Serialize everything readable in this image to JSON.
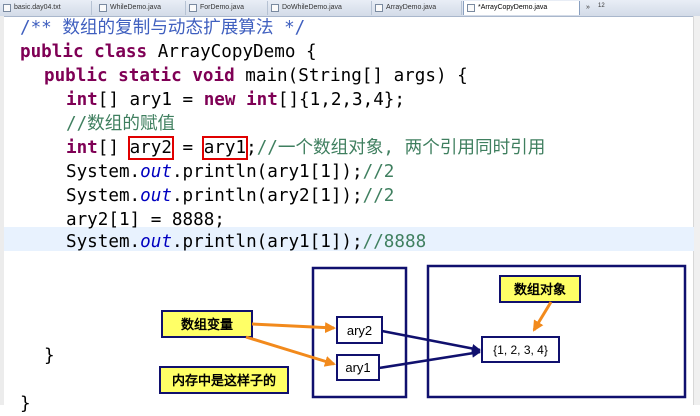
{
  "tabs": [
    {
      "label": "basic.day04.txt",
      "active": false
    },
    {
      "label": "WhileDemo.java",
      "active": false
    },
    {
      "label": "ForDemo.java",
      "active": false
    },
    {
      "label": "DoWhileDemo.java",
      "active": false
    },
    {
      "label": "ArrayDemo.java",
      "active": false
    },
    {
      "label": "*ArrayCopyDemo.java",
      "active": true
    },
    {
      "label": "»",
      "active": false
    },
    {
      "label": "12",
      "active": false
    }
  ],
  "code": {
    "l1_comment": "/** 数组的复制与动态扩展算法 */",
    "l2_public": "public",
    "l2_class": "class",
    "l2_rest": " ArrayCopyDemo {",
    "l3_public": "public",
    "l3_static": "static",
    "l3_void": "void",
    "l3_rest": " main(String[] args) {",
    "l4_int": "int",
    "l4_mid": "[] ary1 = ",
    "l4_new": "new",
    "l4_int2": "int",
    "l4_rest": "[]{1,2,3,4};",
    "l5_comment": "//数组的赋值",
    "l6_int": "int",
    "l6_pre": "[] ",
    "l6_var": "ary2",
    "l6_eq": " = ",
    "l6_val": "ary1",
    "l6_semi": ";",
    "l6_comment": "//一个数组对象, 两个引用同时引用",
    "l7_pre": "System.",
    "l7_out": "out",
    "l7_call": ".println(ary1[1]);",
    "l7_comment": "//2",
    "l8_pre": "System.",
    "l8_out": "out",
    "l8_call": ".println(ary2[1]);",
    "l8_comment": "//2",
    "l9": "ary2[1] = 8888;",
    "l10_pre": "System.",
    "l10_out": "out",
    "l10_call": ".println(ary1[1]);",
    "l10_comment": "//8888",
    "brace_method": "}",
    "brace_class": "}"
  },
  "diagram": {
    "ary2_label": "ary2",
    "ary1_label": "ary1",
    "array_label": "{1, 2, 3, 4}",
    "callout_variable": "数组变量",
    "callout_memory": "内存中是这样子的",
    "callout_object": "数组对象"
  },
  "colors": {
    "keyword": "#7f0055",
    "comment": "#3f7f5f",
    "javadoc": "#3f5fbf",
    "field": "#0000c0",
    "redbox": "#e00000",
    "navy": "#10106e",
    "callout": "#ffff66",
    "arrow_orange": "#f28a1c"
  }
}
